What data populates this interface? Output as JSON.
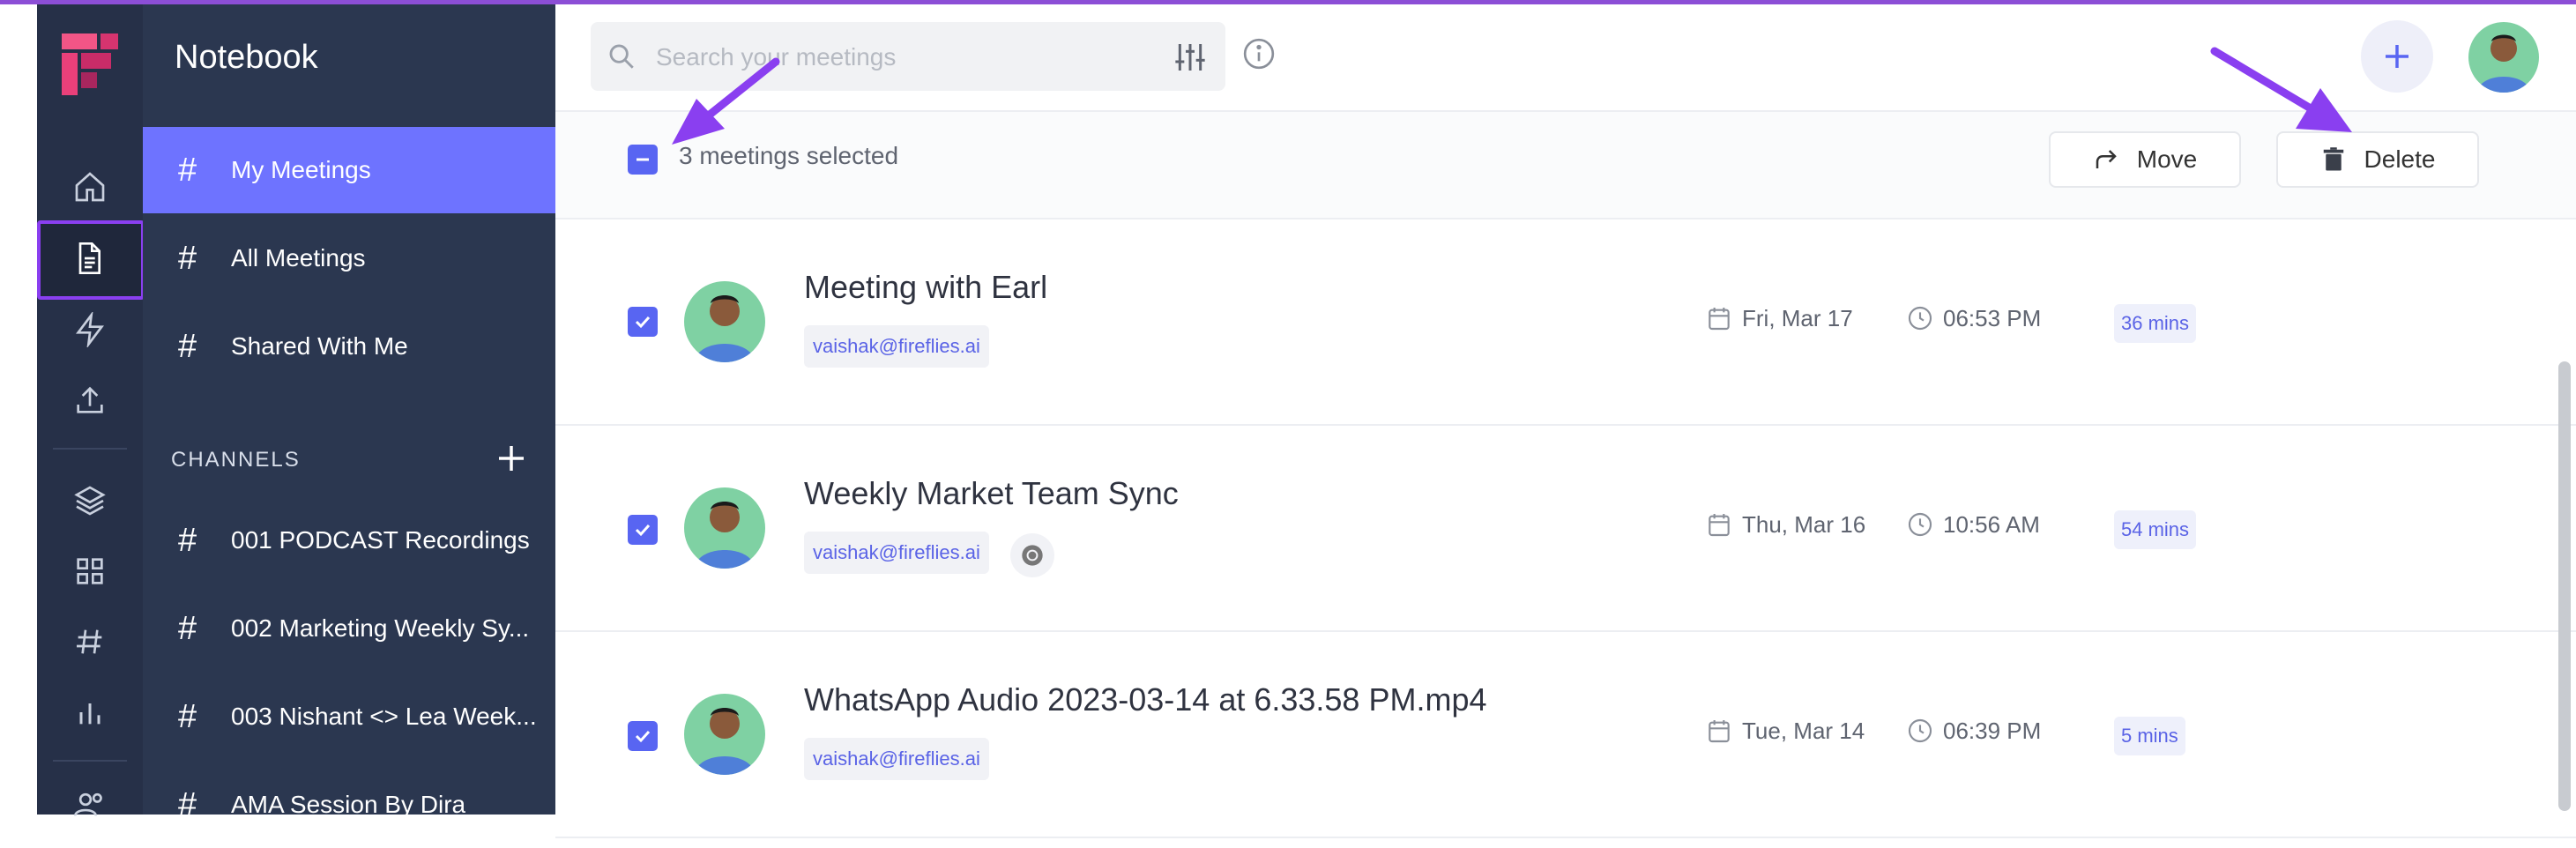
{
  "app": {
    "name": "Notebook"
  },
  "rail": {
    "items": [
      {
        "name": "home-icon"
      },
      {
        "name": "notebook-icon",
        "active": true
      },
      {
        "name": "bolt-icon"
      },
      {
        "name": "upload-icon"
      },
      {
        "name": "layers-icon"
      },
      {
        "name": "apps-grid-icon"
      },
      {
        "name": "hashtag-icon"
      },
      {
        "name": "analytics-icon"
      },
      {
        "name": "people-icon"
      }
    ]
  },
  "sidebar": {
    "title": "Notebook",
    "items": [
      {
        "label": "My Meetings",
        "active": true
      },
      {
        "label": "All Meetings"
      },
      {
        "label": "Shared With Me"
      }
    ],
    "channels_heading": "CHANNELS",
    "channels": [
      {
        "label": "001 PODCAST Recordings"
      },
      {
        "label": "002 Marketing Weekly Sy..."
      },
      {
        "label": "003 Nishant <> Lea Week..."
      },
      {
        "label": "AMA Session By Dira"
      }
    ]
  },
  "search": {
    "placeholder": "Search your meetings"
  },
  "selection": {
    "text": "3 meetings selected",
    "move_label": "Move",
    "delete_label": "Delete"
  },
  "meetings": [
    {
      "title": "Meeting with Earl",
      "email": "vaishak@fireflies.ai",
      "date": "Fri, Mar 17",
      "time": "06:53 PM",
      "duration": "36 mins",
      "selected": true
    },
    {
      "title": "Weekly Market Team Sync",
      "email": "vaishak@fireflies.ai",
      "source_icon": "chrome-icon",
      "date": "Thu, Mar 16",
      "time": "10:56 AM",
      "duration": "54 mins",
      "selected": true
    },
    {
      "title": "WhatsApp Audio 2023-03-14 at 6.33.58 PM.mp4",
      "email": "vaishak@fireflies.ai",
      "date": "Tue, Mar 14",
      "time": "06:39 PM",
      "duration": "5 mins",
      "selected": true
    }
  ],
  "colors": {
    "accent": "#6e73ff",
    "rail_bg": "#263048",
    "sidebar_bg": "#2b3750",
    "annotation": "#8a3ff0",
    "checkbox": "#5865f2"
  }
}
